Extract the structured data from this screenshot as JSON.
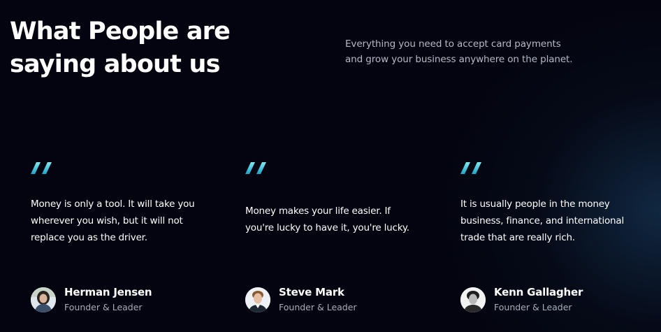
{
  "header": {
    "title_line1": "What People are",
    "title_line2": "saying about us",
    "subtitle_line1": "Everything you need to accept card payments",
    "subtitle_line2": "and grow your business anywhere on the planet."
  },
  "colors": {
    "background": "#03040f",
    "accent_quote_gradient_start": "#7de3ee",
    "accent_quote_gradient_end": "#1aa8c8",
    "text_primary": "#ffffff",
    "text_secondary": "#a9adb8"
  },
  "testimonials": [
    {
      "quote_icon": "quote-icon",
      "quote": "Money is only a tool. It will take you wherever you wish, but it will not replace you as the driver.",
      "name": "Herman Jensen",
      "role": "Founder & Leader"
    },
    {
      "quote_icon": "quote-icon",
      "quote": "Money makes your life easier. If you're lucky to have it, you're lucky.",
      "name": "Steve Mark",
      "role": "Founder & Leader"
    },
    {
      "quote_icon": "quote-icon",
      "quote": "It is usually people in the money business, finance, and international trade that are really rich.",
      "name": "Kenn Gallagher",
      "role": "Founder & Leader"
    }
  ]
}
